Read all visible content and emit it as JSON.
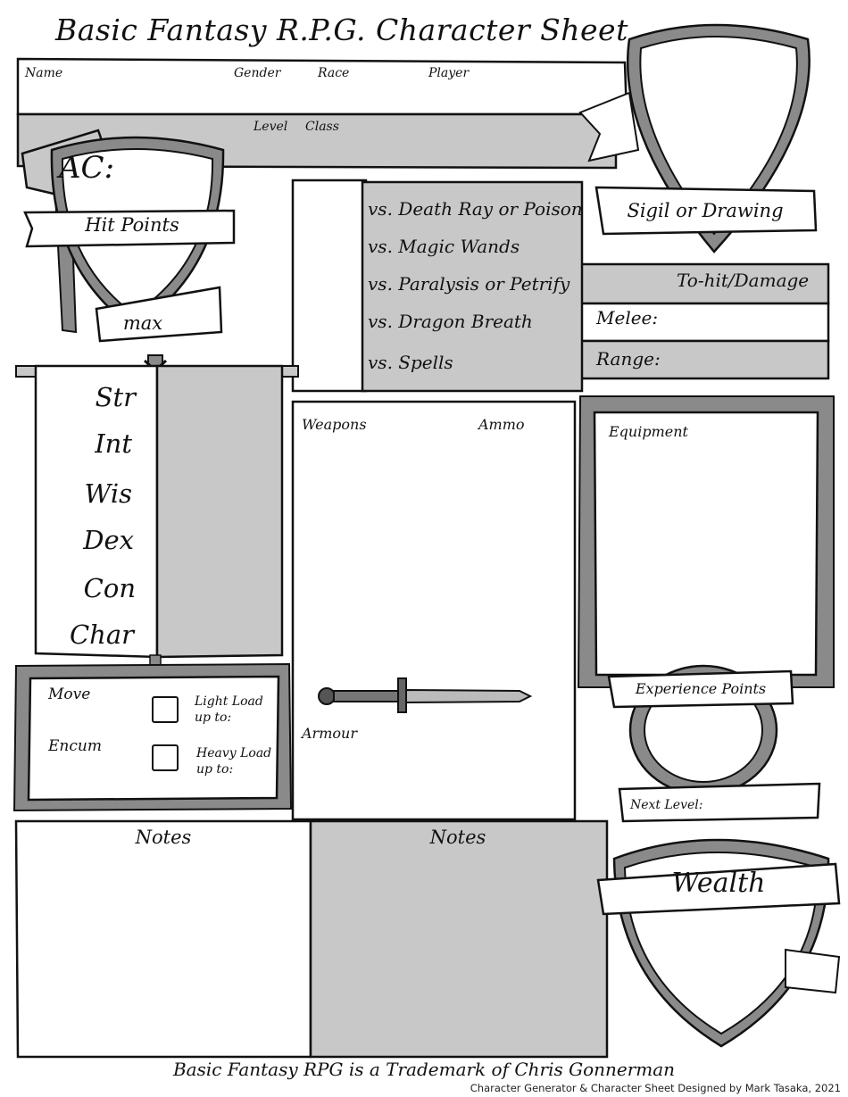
{
  "sheet": {
    "title": "Basic Fantasy R.P.G. Character Sheet",
    "header": {
      "name_label": "Name",
      "gender_label": "Gender",
      "race_label": "Race",
      "player_label": "Player",
      "level_label": "Level",
      "class_label": "Class"
    },
    "ac_label": "AC:",
    "hit_points_label": "Hit Points",
    "max_label": "max",
    "saving_throws": [
      "vs. Death Ray or Poison",
      "vs. Magic Wands",
      "vs. Paralysis or Petrify",
      "vs. Dragon Breath",
      "vs. Spells"
    ],
    "sigil_label": "Sigil or Drawing",
    "attack": {
      "tohit_label": "To-hit/Damage",
      "melee_label": "Melee:",
      "range_label": "Range:"
    },
    "abilities": [
      "Str",
      "Int",
      "Wis",
      "Dex",
      "Con",
      "Char"
    ],
    "movement": {
      "move_label": "Move",
      "encum_label": "Encum",
      "light_load_label": "Light Load",
      "heavy_load_label": "Heavy Load",
      "up_to_label": "up to:"
    },
    "weapons_label": "Weapons",
    "ammo_label": "Ammo",
    "armour_label": "Armour",
    "equipment_label": "Equipment",
    "experience_label": "Experience Points",
    "next_level_label": "Next Level:",
    "notes_left_label": "Notes",
    "notes_right_label": "Notes",
    "wealth_label": "Wealth",
    "footer_trademark": "Basic Fantasy RPG is a Trademark of Chris Gonnerman",
    "footer_credit": "Character Generator & Character Sheet Designed by Mark Tasaka, 2021"
  },
  "colors": {
    "ink": "#111111",
    "shade": "#c8c8c8",
    "mid_shade": "#8a8a8a",
    "paper": "#ffffff"
  },
  "icons": [
    "axe-icon",
    "shield-icon",
    "sword-icon",
    "banner-pole-icon"
  ]
}
